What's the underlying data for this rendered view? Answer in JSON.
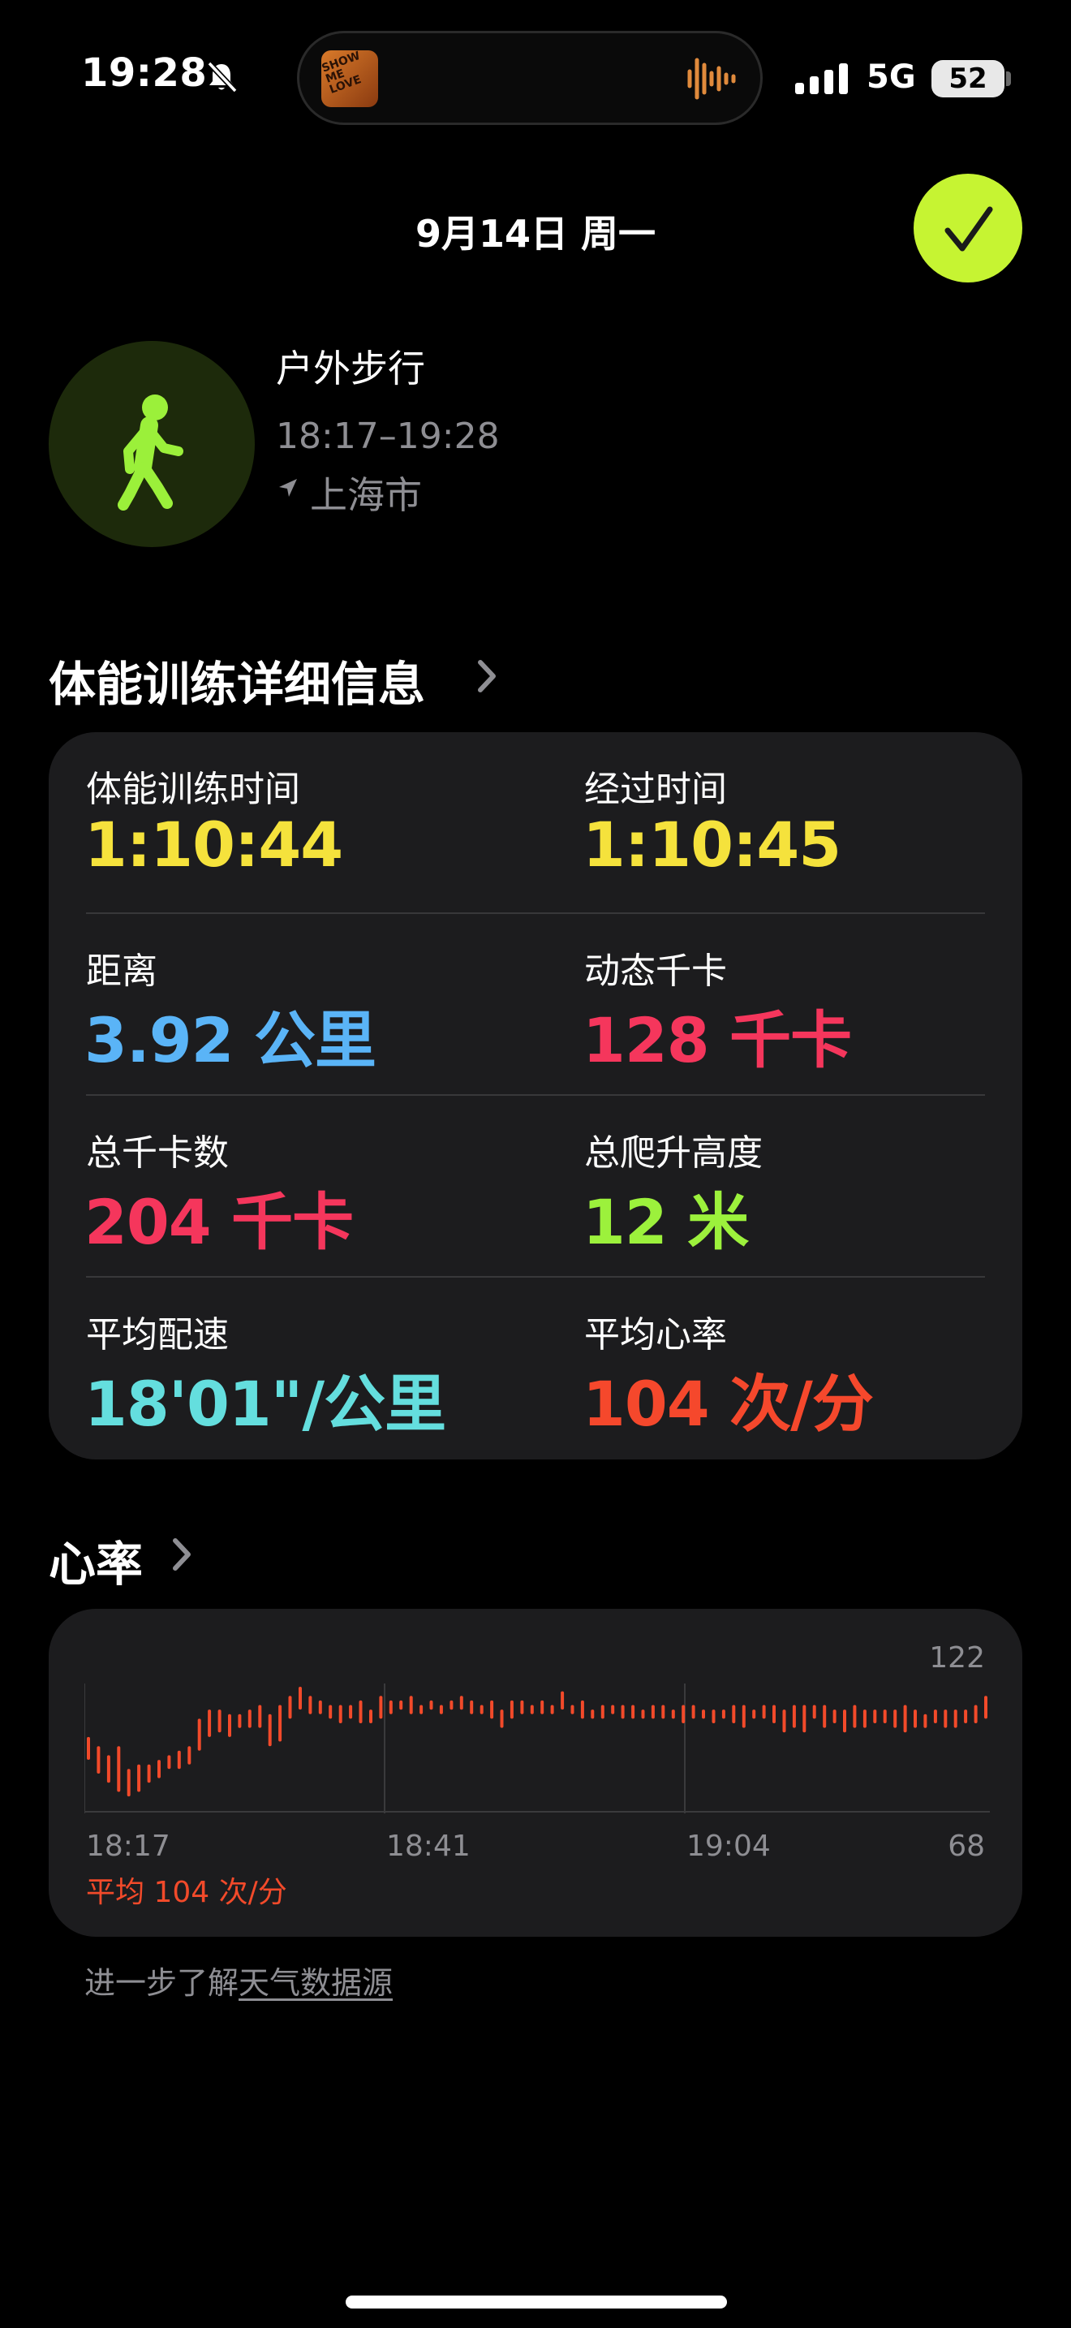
{
  "status_bar": {
    "time": "19:28",
    "network": "5G",
    "battery": "52",
    "album_text": "SHOW ME LOVE"
  },
  "header": {
    "date": "9月14日 周一"
  },
  "workout": {
    "type": "户外步行",
    "time_range": "18:17–19:28",
    "location": "上海市",
    "icon": "walking-figure-icon",
    "accent": "#9bf03a"
  },
  "details": {
    "title": "体能训练详细信息",
    "metrics": [
      {
        "label": "体能训练时间",
        "value": "1:10:44",
        "color": "#f5e23c"
      },
      {
        "label": "经过时间",
        "value": "1:10:45",
        "color": "#f5e23c"
      },
      {
        "label": "距离",
        "value": "3.92 公里",
        "color": "#5ab4f7"
      },
      {
        "label": "动态千卡",
        "value": "128 千卡",
        "color": "#f5365c"
      },
      {
        "label": "总千卡数",
        "value": "204 千卡",
        "color": "#f5365c"
      },
      {
        "label": "总爬升高度",
        "value": "12 米",
        "color": "#9cf13c"
      },
      {
        "label": "平均配速",
        "value": "18'01\"/公里",
        "color": "#64dede"
      },
      {
        "label": "平均心率",
        "value": "104 次/分",
        "color": "#f5482c"
      }
    ]
  },
  "heart_rate": {
    "title": "心率",
    "max_label": "122",
    "min_label": "68",
    "x_labels": [
      "18:17",
      "18:41",
      "19:04"
    ],
    "average": "平均 104 次/分"
  },
  "chart_data": {
    "type": "bar",
    "ylim": [
      68,
      122
    ],
    "color": "#f24a2a",
    "bars": [
      [
        90,
        100
      ],
      [
        84,
        96
      ],
      [
        80,
        92
      ],
      [
        76,
        96
      ],
      [
        74,
        86
      ],
      [
        76,
        88
      ],
      [
        80,
        88
      ],
      [
        82,
        90
      ],
      [
        86,
        92
      ],
      [
        86,
        94
      ],
      [
        88,
        96
      ],
      [
        94,
        108
      ],
      [
        100,
        112
      ],
      [
        102,
        112
      ],
      [
        100,
        110
      ],
      [
        104,
        110
      ],
      [
        104,
        112
      ],
      [
        104,
        114
      ],
      [
        96,
        110
      ],
      [
        98,
        114
      ],
      [
        108,
        118
      ],
      [
        112,
        122
      ],
      [
        110,
        118
      ],
      [
        110,
        116
      ],
      [
        108,
        114
      ],
      [
        106,
        114
      ],
      [
        108,
        114
      ],
      [
        106,
        116
      ],
      [
        106,
        112
      ],
      [
        108,
        118
      ],
      [
        110,
        116
      ],
      [
        112,
        116
      ],
      [
        110,
        118
      ],
      [
        110,
        114
      ],
      [
        112,
        116
      ],
      [
        110,
        114
      ],
      [
        112,
        116
      ],
      [
        112,
        118
      ],
      [
        110,
        116
      ],
      [
        110,
        114
      ],
      [
        108,
        116
      ],
      [
        104,
        112
      ],
      [
        108,
        116
      ],
      [
        110,
        116
      ],
      [
        110,
        114
      ],
      [
        110,
        116
      ],
      [
        110,
        114
      ],
      [
        112,
        120
      ],
      [
        110,
        114
      ],
      [
        108,
        116
      ],
      [
        108,
        112
      ],
      [
        108,
        114
      ],
      [
        110,
        114
      ],
      [
        108,
        114
      ],
      [
        108,
        114
      ],
      [
        108,
        112
      ],
      [
        108,
        114
      ],
      [
        108,
        114
      ],
      [
        108,
        112
      ],
      [
        106,
        114
      ],
      [
        108,
        114
      ],
      [
        108,
        112
      ],
      [
        106,
        112
      ],
      [
        108,
        112
      ],
      [
        106,
        114
      ],
      [
        104,
        114
      ],
      [
        108,
        112
      ],
      [
        108,
        114
      ],
      [
        106,
        114
      ],
      [
        102,
        112
      ],
      [
        104,
        114
      ],
      [
        102,
        114
      ],
      [
        108,
        114
      ],
      [
        104,
        114
      ],
      [
        106,
        112
      ],
      [
        102,
        112
      ],
      [
        104,
        114
      ],
      [
        104,
        112
      ],
      [
        106,
        112
      ],
      [
        106,
        112
      ],
      [
        104,
        112
      ],
      [
        102,
        114
      ],
      [
        104,
        112
      ],
      [
        104,
        110
      ],
      [
        106,
        112
      ],
      [
        104,
        112
      ],
      [
        104,
        112
      ],
      [
        106,
        112
      ],
      [
        106,
        114
      ],
      [
        108,
        118
      ]
    ]
  },
  "footer": {
    "prefix": "进一步了解",
    "link": "天气数据源"
  }
}
